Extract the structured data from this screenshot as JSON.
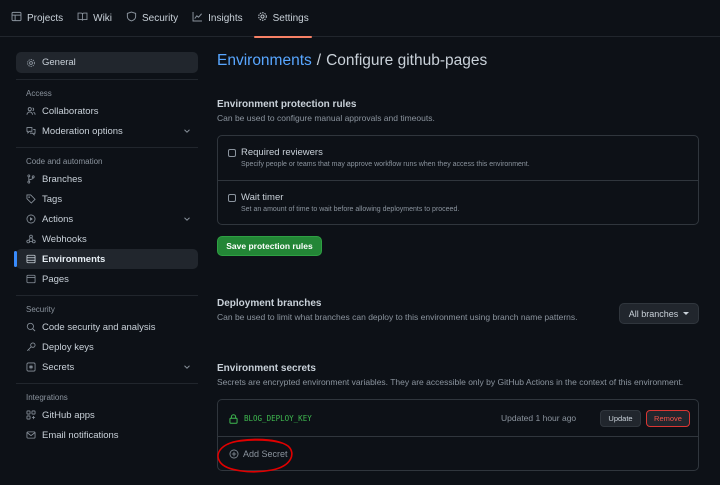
{
  "topnav": {
    "tabs": [
      {
        "label": "Projects",
        "icon": "table-icon"
      },
      {
        "label": "Wiki",
        "icon": "book-icon"
      },
      {
        "label": "Security",
        "icon": "shield-icon"
      },
      {
        "label": "Insights",
        "icon": "graph-icon"
      },
      {
        "label": "Settings",
        "icon": "gear-icon",
        "active": true
      }
    ]
  },
  "sidebar": {
    "general": "General",
    "access_heading": "Access",
    "collaborators": "Collaborators",
    "moderation": "Moderation options",
    "code_heading": "Code and automation",
    "branches": "Branches",
    "tags": "Tags",
    "actions": "Actions",
    "webhooks": "Webhooks",
    "environments": "Environments",
    "pages": "Pages",
    "security_heading": "Security",
    "code_security": "Code security and analysis",
    "deploy_keys": "Deploy keys",
    "secrets": "Secrets",
    "integrations_heading": "Integrations",
    "github_apps": "GitHub apps",
    "email_notifications": "Email notifications"
  },
  "main": {
    "breadcrumb": "Environments",
    "slash": "/",
    "title": "Configure github-pages",
    "protection": {
      "title": "Environment protection rules",
      "desc": "Can be used to configure manual approvals and timeouts.",
      "rules": [
        {
          "title": "Required reviewers",
          "desc": "Specify people or teams that may approve workflow runs when they access this environment.",
          "checked": false
        },
        {
          "title": "Wait timer",
          "desc": "Set an amount of time to wait before allowing deployments to proceed.",
          "checked": false
        }
      ],
      "save_label": "Save protection rules"
    },
    "branches": {
      "title": "Deployment branches",
      "desc": "Can be used to limit what branches can deploy to this environment using branch name patterns.",
      "select_label": "All branches"
    },
    "secrets": {
      "title": "Environment secrets",
      "desc": "Secrets are encrypted environment variables. They are accessible only by GitHub Actions in the context of this environment.",
      "items": [
        {
          "name": "BLOG_DEPLOY_KEY",
          "updated": "Updated 1 hour ago",
          "update_label": "Update",
          "remove_label": "Remove"
        }
      ],
      "add_label": "Add Secret"
    }
  },
  "colors": {
    "background": "#0d1117",
    "accent_link": "#58a6ff",
    "primary_button": "#238636",
    "danger": "#f85149",
    "secret_name": "#3fb950",
    "annotation_circle": "#e00000"
  }
}
